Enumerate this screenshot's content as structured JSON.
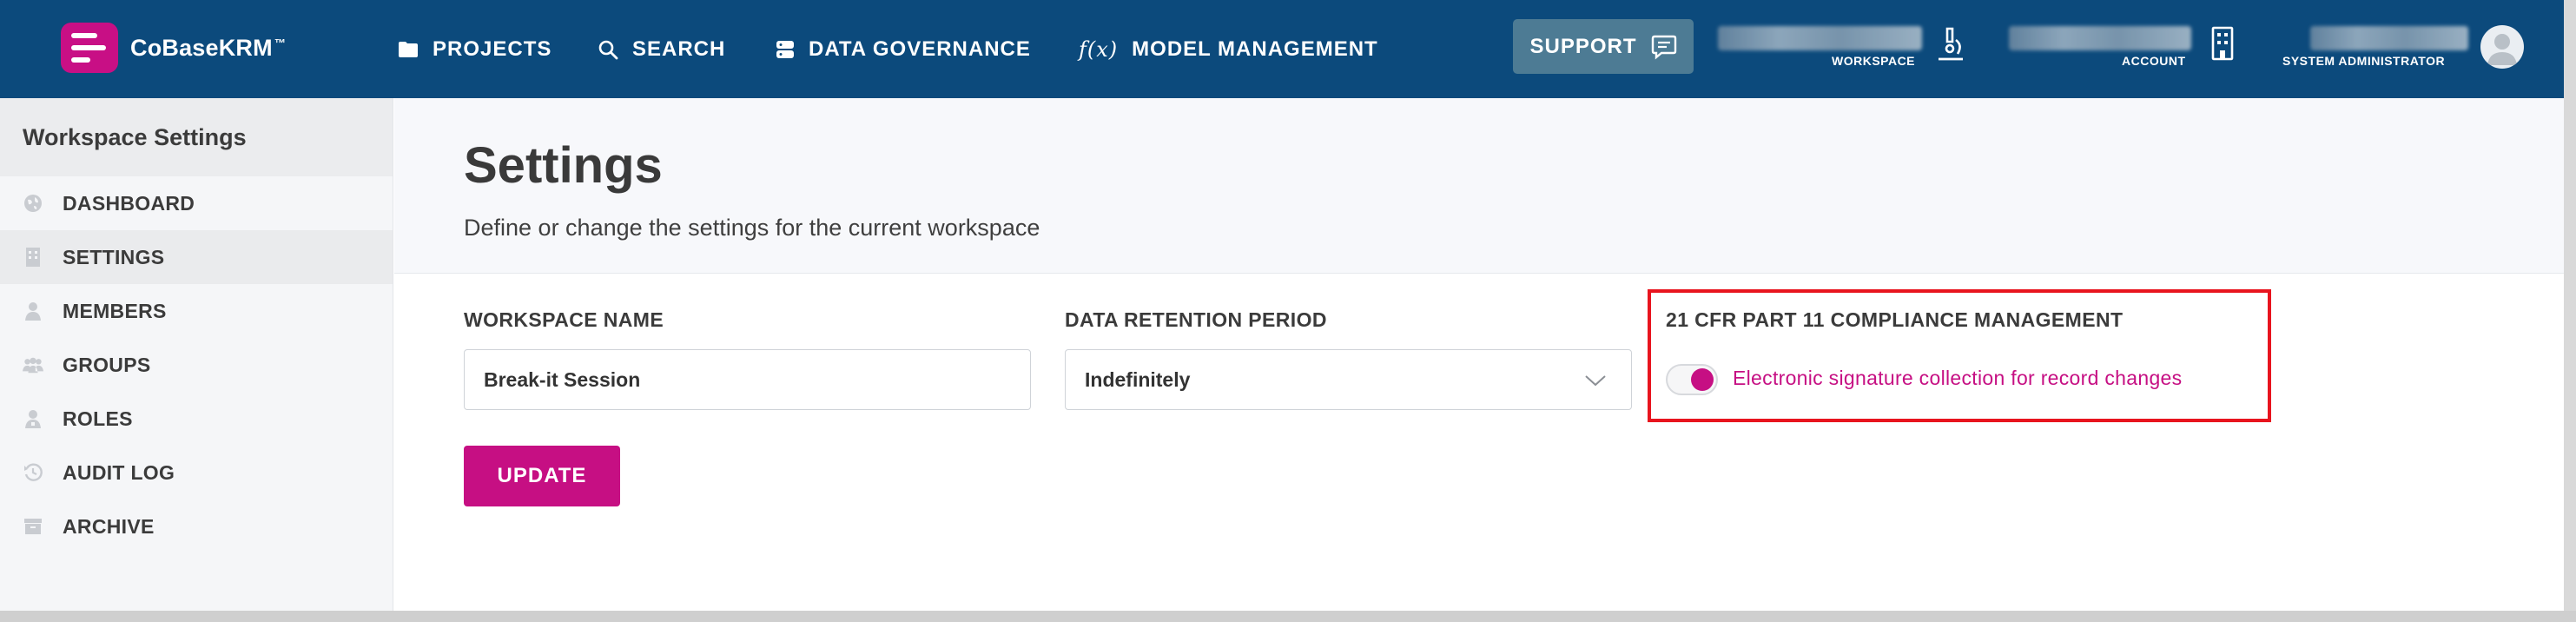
{
  "brand": {
    "name": "CoBaseKRM",
    "trademark": "™",
    "accent": "#c80f85"
  },
  "topnav": {
    "items": [
      {
        "label": "PROJECTS",
        "icon": "folder-icon"
      },
      {
        "label": "SEARCH",
        "icon": "search-icon"
      },
      {
        "label": "DATA GOVERNANCE",
        "icon": "database-icon"
      },
      {
        "label": "MODEL MANAGEMENT",
        "icon": "function-icon",
        "icon_text": "f(x)"
      }
    ],
    "support": {
      "label": "SUPPORT",
      "icon": "chat-icon"
    },
    "workspace_label": "WORKSPACE",
    "account_label": "ACCOUNT",
    "user_role": "SYSTEM ADMINISTRATOR",
    "background": "#0c4a7c"
  },
  "sidebar": {
    "title": "Workspace Settings",
    "items": [
      {
        "label": "DASHBOARD",
        "icon": "globe-icon"
      },
      {
        "label": "SETTINGS",
        "icon": "building-icon",
        "active": true
      },
      {
        "label": "MEMBERS",
        "icon": "user-icon"
      },
      {
        "label": "GROUPS",
        "icon": "group-icon"
      },
      {
        "label": "ROLES",
        "icon": "user-badge-icon"
      },
      {
        "label": "AUDIT LOG",
        "icon": "history-icon"
      },
      {
        "label": "ARCHIVE",
        "icon": "archive-icon"
      }
    ]
  },
  "main": {
    "title": "Settings",
    "subtitle": "Define or change the settings for the current workspace",
    "workspace_name": {
      "label": "WORKSPACE NAME",
      "value": "Break-it Session"
    },
    "retention": {
      "label": "DATA RETENTION PERIOD",
      "value": "Indefinitely"
    },
    "cfr": {
      "label": "21 CFR PART 11 COMPLIANCE MANAGEMENT",
      "toggle_label": "Electronic signature collection for record changes",
      "enabled": true,
      "highlight_color": "#e8141e"
    },
    "update_label": "UPDATE",
    "accent": "#c60f83"
  }
}
